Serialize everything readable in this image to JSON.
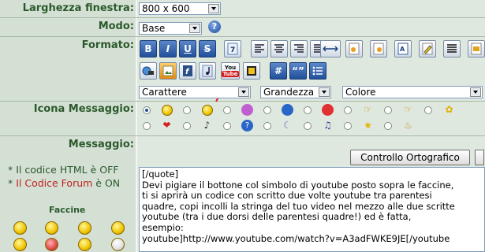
{
  "labels": {
    "window_width": "Larghezza finestra:",
    "mode": "Modo:",
    "format": "Formato:",
    "message_icon": "Icona Messaggio:",
    "message": "Messaggio:"
  },
  "window_width_select": {
    "value": "800 x 600"
  },
  "mode_select": {
    "value": "Base"
  },
  "help_icon": {
    "text": "?"
  },
  "format_buttons_row1": [
    "B",
    "I",
    "U",
    "S",
    "",
    "",
    "",
    "",
    "",
    "",
    "",
    "",
    "",
    "",
    "",
    ""
  ],
  "format_buttons_row2": [
    "",
    "",
    "",
    "",
    "YouTube",
    "",
    "#",
    "“”",
    ""
  ],
  "youtube_button": {
    "top": "You",
    "bottom": "Tube"
  },
  "selects": {
    "font": "Carattere",
    "size": "Grandezza",
    "color": "Colore"
  },
  "spell_check_button": "Controllo Ortografico",
  "notes": {
    "html_label": "* Il codice HTML è OFF",
    "forum_prefix": "* ",
    "forum_label": "Il Codice Forum",
    "forum_suffix": " è ON"
  },
  "smilies_title": "Faccine",
  "message_text": "[/quote]\nDevi pigiare il bottone col simbolo di youtube posto sopra le faccine,\nti si aprirà un codice con scritto due volte youtube tra parentesi\nquadre, copi incolli la stringa del tuo video nel mezzo alle due scritte\nyoutube (tra i due dorsi delle parentesi quadre!) ed è fatta,\nesempio:\nyoutube]http://www.youtube.com/watch?v=A3adFWKE9JE[/youtube",
  "colors": {
    "label_green": "#2c5a2c",
    "forum_red": "#c0201c",
    "arrow_red": "#e02020"
  }
}
